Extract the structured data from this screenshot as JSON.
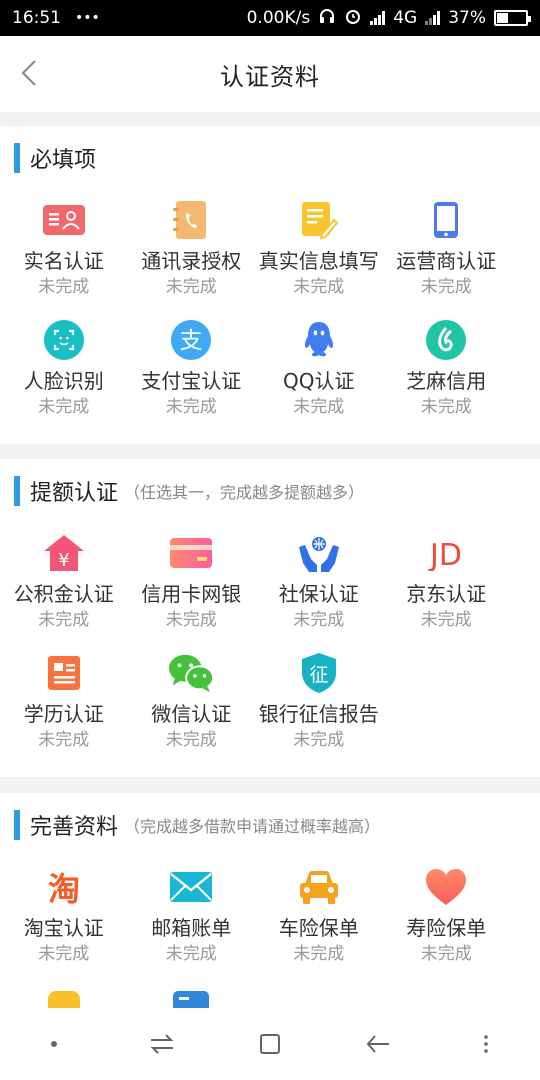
{
  "status": {
    "time": "16:51",
    "dots": "•••",
    "speed": "0.00K/s",
    "net": "4G",
    "battery": "37%",
    "battery_level": 0.37
  },
  "header": {
    "title": "认证资料"
  },
  "required": {
    "title": "必填项",
    "items": [
      {
        "label": "实名认证",
        "status": "未完成",
        "icon": "id-card-icon"
      },
      {
        "label": "通讯录授权",
        "status": "未完成",
        "icon": "contacts-book-icon"
      },
      {
        "label": "真实信息填写",
        "status": "未完成",
        "icon": "edit-form-icon"
      },
      {
        "label": "运营商认证",
        "status": "未完成",
        "icon": "mobile-phone-icon"
      },
      {
        "label": "人脸识别",
        "status": "未完成",
        "icon": "face-scan-icon"
      },
      {
        "label": "支付宝认证",
        "status": "未完成",
        "icon": "alipay-icon",
        "glyph": "支"
      },
      {
        "label": "QQ认证",
        "status": "未完成",
        "icon": "qq-icon"
      },
      {
        "label": "芝麻信用",
        "status": "未完成",
        "icon": "sesame-credit-icon"
      }
    ]
  },
  "boost": {
    "title": "提额认证",
    "subtitle": "（任选其一，完成越多提额越多）",
    "items": [
      {
        "label": "公积金认证",
        "status": "未完成",
        "icon": "housing-fund-icon",
        "glyph": "¥"
      },
      {
        "label": "信用卡网银",
        "status": "未完成",
        "icon": "credit-card-icon"
      },
      {
        "label": "社保认证",
        "status": "未完成",
        "icon": "social-security-icon"
      },
      {
        "label": "京东认证",
        "status": "未完成",
        "icon": "jd-icon",
        "glyph": "JD"
      },
      {
        "label": "学历认证",
        "status": "未完成",
        "icon": "education-icon"
      },
      {
        "label": "微信认证",
        "status": "未完成",
        "icon": "wechat-icon"
      },
      {
        "label": "银行征信报告",
        "status": "未完成",
        "icon": "credit-report-shield-icon",
        "glyph": "征"
      }
    ]
  },
  "improve": {
    "title": "完善资料",
    "subtitle": "（完成越多借款申请通过概率越高）",
    "items": [
      {
        "label": "淘宝认证",
        "status": "未完成",
        "icon": "taobao-icon",
        "glyph": "淘"
      },
      {
        "label": "邮箱账单",
        "status": "未完成",
        "icon": "mail-icon"
      },
      {
        "label": "车险保单",
        "status": "未完成",
        "icon": "car-icon"
      },
      {
        "label": "寿险保单",
        "status": "未完成",
        "icon": "heart-icon"
      }
    ]
  },
  "colors": {
    "accent": "#2e9be6",
    "text": "#333333",
    "muted": "#999999"
  }
}
